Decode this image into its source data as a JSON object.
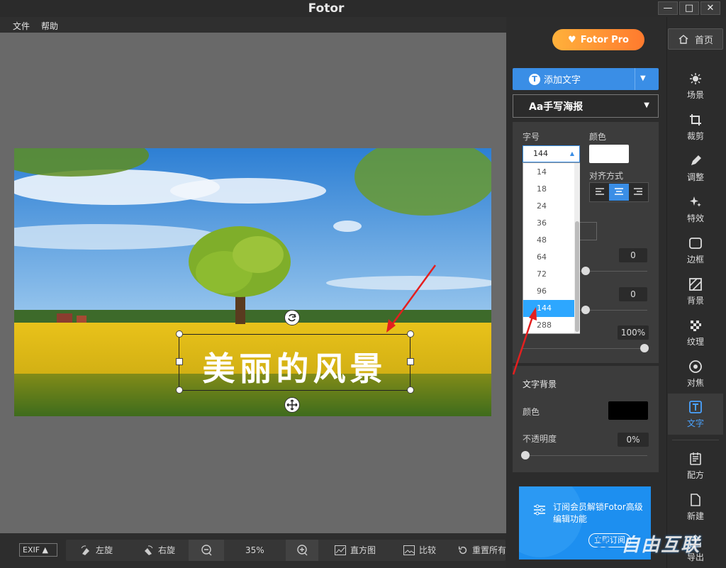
{
  "window": {
    "title": "Fotor",
    "minimize": "—",
    "maximize": "□",
    "close": "✕"
  },
  "menu": [
    {
      "label": "文件"
    },
    {
      "label": "帮助"
    }
  ],
  "canvas_text": "美丽的风景",
  "bottom_toolbar": {
    "exif": "EXIF",
    "rotate_left": "左旋",
    "rotate_right": "右旋",
    "zoom": "35%",
    "histogram": "直方图",
    "compare": "比较",
    "reset": "重置所有"
  },
  "header": {
    "pro": "Fotor Pro",
    "home": "首页"
  },
  "side_nav": [
    {
      "label": "场景",
      "icon": "sun-icon"
    },
    {
      "label": "裁剪",
      "icon": "crop-icon"
    },
    {
      "label": "调整",
      "icon": "pencil-icon"
    },
    {
      "label": "特效",
      "icon": "sparkle-icon"
    },
    {
      "label": "边框",
      "icon": "frame-icon"
    },
    {
      "label": "背景",
      "icon": "background-icon"
    },
    {
      "label": "纹理",
      "icon": "texture-icon"
    },
    {
      "label": "对焦",
      "icon": "focus-icon"
    },
    {
      "label": "文字",
      "icon": "text-icon"
    },
    {
      "label": "配方",
      "icon": "recipe-icon"
    },
    {
      "label": "新建",
      "icon": "new-file-icon"
    },
    {
      "label": "导出",
      "icon": "export-icon"
    }
  ],
  "text_panel": {
    "add_text": "添加文字",
    "font_name": "Aa手写海报",
    "size_label": "字号",
    "color_label": "颜色",
    "size_value": "144",
    "size_options": [
      "14",
      "18",
      "24",
      "36",
      "48",
      "64",
      "72",
      "96",
      "144",
      "288"
    ],
    "align_label": "对齐方式",
    "spacing_value_1": "0",
    "spacing_value_2": "0",
    "opacity_value": "100%",
    "text_color": "#ffffff"
  },
  "text_background": {
    "title": "文字背景",
    "color_label": "颜色",
    "opacity_label": "不透明度",
    "opacity_value": "0%",
    "color": "#000000"
  },
  "promo": {
    "text": "订阅会员解锁Fotor高级编辑功能",
    "button": "立即订阅"
  },
  "watermark": "自由互联",
  "colors": {
    "accent": "#3a8ee6",
    "selected_option": "#2da7ff",
    "arrow": "#e41f1f"
  }
}
